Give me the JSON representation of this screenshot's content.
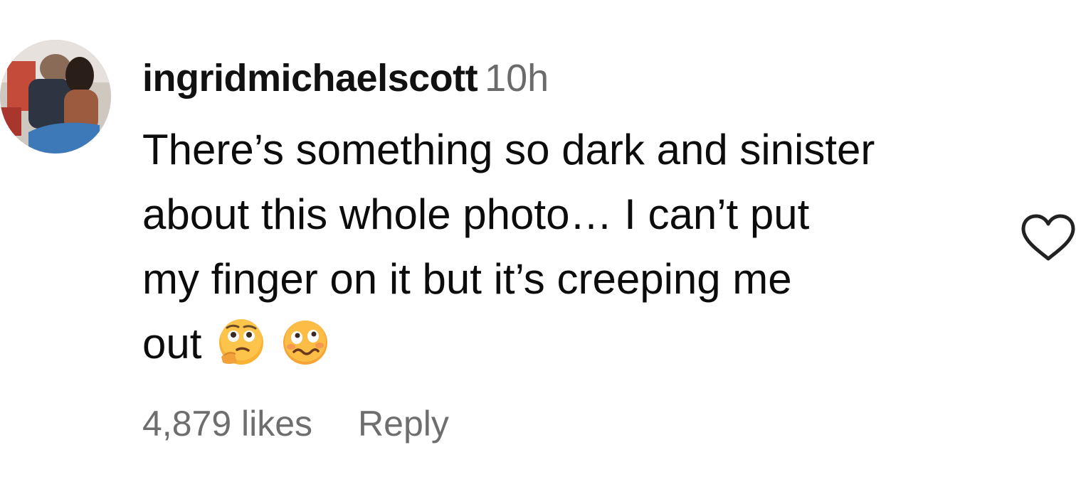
{
  "comment": {
    "username": "ingridmichaelscott",
    "timestamp": "10h",
    "text_lines": [
      "There’s something so dark and sinister",
      "about this whole photo… I can’t put",
      "my finger on it but it’s creeping me",
      "out"
    ],
    "emojis": [
      "thinking-face-emoji",
      "woozy-face-emoji"
    ],
    "likes_label": "4,879 likes",
    "reply_label": "Reply",
    "heart_icon": "heart-outline-icon"
  },
  "colors": {
    "text": "#0c0c0c",
    "muted": "#6e6e6e",
    "emoji_yellow": "#f9b233"
  }
}
